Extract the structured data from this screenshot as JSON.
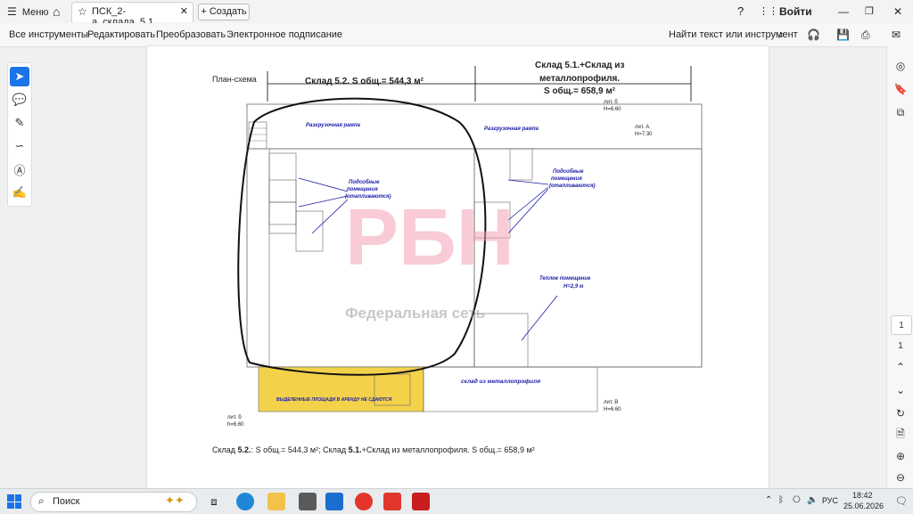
{
  "titlebar": {
    "menu_label": "Меню",
    "tab_label": "ПСК_2-а_склада_5.1...",
    "new_tab_label": "Создать",
    "signin_label": "Войти"
  },
  "toolbar": {
    "items": [
      "Все инструменты",
      "Редактировать",
      "Преобразовать",
      "Электронное подписание"
    ],
    "find_label": "Найти текст или инструмент"
  },
  "document": {
    "plan_label": "План-схема",
    "header_left": "Склад 5.2.  S общ.= 544,3 м²",
    "header_right_line1": "Склад 5.1.+Склад из",
    "header_right_line2": "металлопрофиля.",
    "header_right_line3": "S общ.= 658,9 м²",
    "unloading_left": "Разгрузочная рампа",
    "unloading_right": "Разгрузочная рампа",
    "aux_left_line1": "Подсобные",
    "aux_left_line2": "помещения",
    "aux_left_line3": "(отапливаются)",
    "aux_right_line1": "Подсобные",
    "aux_right_line2": "помещения",
    "aux_right_line3": "(отапливаются)",
    "warm_room_line1": "Теплое помещение",
    "warm_room_line2": "Н=2,9 м",
    "metal_warehouse": "склад  из  металлопрофиля",
    "not_rented": "ВЫДЕЛЕННЫЕ ПЛОЩАДИ В АРЕНДУ НЕ СДАЮТСЯ",
    "lit_a": "лит. А",
    "lit_a_h": "Н=7.30",
    "lit_b_top": "лит. б",
    "lit_b_top_h": "Н=6.60",
    "lit_b_bottom": "лит. б",
    "lit_b_bottom_h": "h=6.60",
    "lit_v": "лит. В",
    "lit_v_h": "Н=6.60",
    "watermark_logo": "РБН",
    "watermark_text": "Федеральная сеть",
    "footer_part1": "Склад ",
    "footer_5_2": "5.2.",
    "footer_part2": ": S общ.= 544,3 м²; Склад ",
    "footer_5_1": "5.1.",
    "footer_part3": "+Склад из металлопрофиля. S общ.= 658,9 м²"
  },
  "right_rail": {
    "page_current": "1",
    "page_total": "1"
  },
  "taskbar": {
    "search_label": "Поиск",
    "language": "РУС",
    "time": "18:42",
    "date": "25.06.2026"
  },
  "colors": {
    "accent": "#1a73e8",
    "plan_blue": "#1a1aa8",
    "yellow_area": "#f3d24a",
    "watermark_pink": "#f2a0b4"
  }
}
